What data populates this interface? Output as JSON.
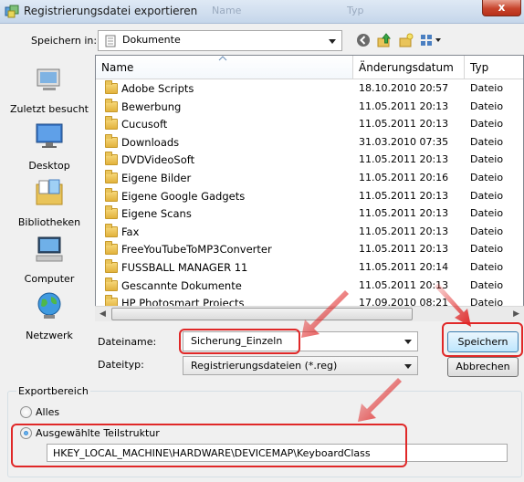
{
  "window": {
    "title": "Registrierungsdatei exportieren",
    "ghost_title_1": "Name",
    "ghost_title_2": "Typ",
    "close_label": "x"
  },
  "save_in": {
    "label": "Speichern in:",
    "value": "Dokumente"
  },
  "places": [
    {
      "label": "Zuletzt besucht",
      "icon": "recent-places-icon"
    },
    {
      "label": "Desktop",
      "icon": "desktop-icon"
    },
    {
      "label": "Bibliotheken",
      "icon": "libraries-icon"
    },
    {
      "label": "Computer",
      "icon": "computer-icon"
    },
    {
      "label": "Netzwerk",
      "icon": "network-icon"
    }
  ],
  "columns": {
    "name": "Name",
    "date": "Änderungsdatum",
    "type": "Typ"
  },
  "files": [
    {
      "name": "Adobe Scripts",
      "date": "18.10.2010 20:57",
      "type": "Dateio"
    },
    {
      "name": "Bewerbung",
      "date": "11.05.2011 20:13",
      "type": "Dateio"
    },
    {
      "name": "Cucusoft",
      "date": "11.05.2011 20:13",
      "type": "Dateio"
    },
    {
      "name": "Downloads",
      "date": "31.03.2010 07:35",
      "type": "Dateio"
    },
    {
      "name": "DVDVideoSoft",
      "date": "11.05.2011 20:13",
      "type": "Dateio"
    },
    {
      "name": "Eigene Bilder",
      "date": "11.05.2011 20:16",
      "type": "Dateio"
    },
    {
      "name": "Eigene Google Gadgets",
      "date": "11.05.2011 20:13",
      "type": "Dateio"
    },
    {
      "name": "Eigene Scans",
      "date": "11.05.2011 20:13",
      "type": "Dateio"
    },
    {
      "name": "Fax",
      "date": "11.05.2011 20:13",
      "type": "Dateio"
    },
    {
      "name": "FreeYouTubeToMP3Converter",
      "date": "11.05.2011 20:13",
      "type": "Dateio"
    },
    {
      "name": "FUSSBALL MANAGER 11",
      "date": "11.05.2011 20:14",
      "type": "Dateio"
    },
    {
      "name": "Gescannte Dokumente",
      "date": "11.05.2011 20:13",
      "type": "Dateio"
    },
    {
      "name": "HP Photosmart Projects",
      "date": "17.09.2010 08:21",
      "type": "Dateio"
    }
  ],
  "filename": {
    "label": "Dateiname:",
    "value": "Sicherung_Einzeln"
  },
  "filetype": {
    "label": "Dateityp:",
    "value": "Registrierungsdateien (*.reg)"
  },
  "buttons": {
    "save": "Speichern",
    "cancel": "Abbrechen"
  },
  "export_range": {
    "legend": "Exportbereich",
    "all_label": "Alles",
    "selected_label": "Ausgewählte Teilstruktur",
    "branch_value": "HKEY_LOCAL_MACHINE\\HARDWARE\\DEVICEMAP\\KeyboardClass"
  },
  "colors": {
    "annotation": "#e02828",
    "title_bar": "#c5d6ea",
    "save_button_border": "#3c7fb1"
  }
}
